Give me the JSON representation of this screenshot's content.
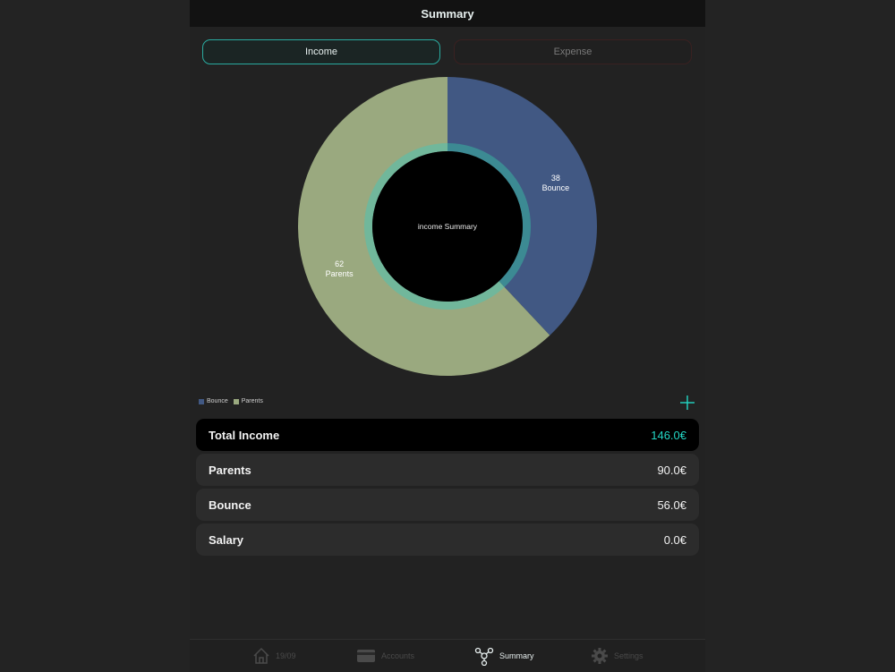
{
  "header": {
    "title": "Summary"
  },
  "segments": {
    "income_label": "Income",
    "expense_label": "Expense"
  },
  "chart_data": {
    "type": "pie",
    "center_label": "income Summary",
    "slices": [
      {
        "name": "Bounce",
        "value": 38,
        "value_label": "38",
        "color": "#415883"
      },
      {
        "name": "Parents",
        "value": 62,
        "value_label": "62",
        "color": "#9aa97f"
      }
    ],
    "inner_ring_colors": [
      "#3c8a93",
      "#71b79b"
    ],
    "legend_position": "bottom-left"
  },
  "legend": {
    "items": [
      "Bounce",
      "Parents"
    ]
  },
  "summary": {
    "total": {
      "label": "Total Income",
      "value": "146.0€"
    },
    "rows": [
      {
        "label": "Parents",
        "value": "90.0€"
      },
      {
        "label": "Bounce",
        "value": "56.0€"
      },
      {
        "label": "Salary",
        "value": "0.0€"
      }
    ]
  },
  "tabbar": {
    "items": [
      {
        "label": "19/09",
        "icon": "house-icon"
      },
      {
        "label": "Accounts",
        "icon": "wallet-icon"
      },
      {
        "label": "Summary",
        "icon": "summary-icon"
      },
      {
        "label": "Settings",
        "icon": "gear-icon"
      }
    ],
    "active": "Summary"
  },
  "colors": {
    "accent": "#23d6c4",
    "background": "#222222",
    "row": "#2c2c2c"
  }
}
